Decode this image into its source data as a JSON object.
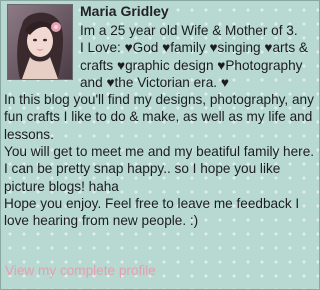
{
  "profile": {
    "name": "Maria Gridley",
    "avatar_alt": "Profile photo",
    "bio_lines": [
      "Im a 25 year old Wife & Mother of 3.",
      "I Love: ♥God ♥family ♥singing ♥arts &",
      "crafts ♥graphic design ♥Photography",
      "and ♥the Victorian era. ♥",
      "In this blog you'll find my designs, photography, any",
      "fun crafts I like to do & make, as well as my life and",
      "lessons.",
      "You will get to meet me and my beatiful family here.",
      "I can be pretty snap happy.. so I hope you like",
      "picture blogs! haha",
      "Hope you enjoy. Feel free to leave me feedback I",
      "love hearing from new people. :)"
    ],
    "link_label": "View my complete profile"
  },
  "colors": {
    "background": "#b7d9d2",
    "link": "#e4a0ae",
    "text": "#1d1d1d"
  }
}
